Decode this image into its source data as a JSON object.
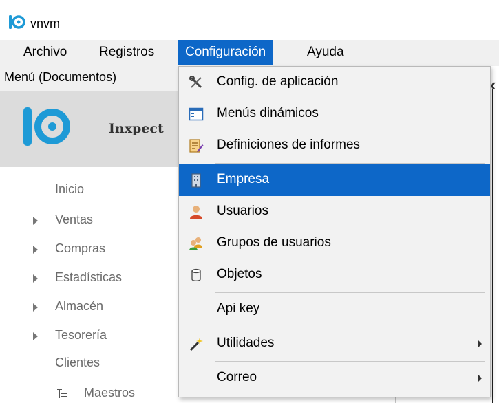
{
  "window": {
    "title": "vnvm"
  },
  "menubar": {
    "items": [
      "Archivo",
      "Registros",
      "Configuración",
      "Ayuda"
    ]
  },
  "left_panel": {
    "header": "Menú (Documentos)",
    "logo_text": "Inxpect",
    "tree": [
      "Inicio",
      "Ventas",
      "Compras",
      "Estadísticas",
      "Almacén",
      "Tesorería",
      "Clientes",
      "Maestros"
    ]
  },
  "dropdown": {
    "items": [
      {
        "label": "Config. de aplicación",
        "icon": "wrench-screwdriver-icon"
      },
      {
        "label": "Menús dinámicos",
        "icon": "window-list-icon"
      },
      {
        "label": "Definiciones de informes",
        "icon": "report-edit-icon"
      },
      {
        "label": "Empresa",
        "icon": "building-icon"
      },
      {
        "label": "Usuarios",
        "icon": "user-icon"
      },
      {
        "label": "Grupos de usuarios",
        "icon": "users-group-icon"
      },
      {
        "label": "Objetos",
        "icon": "cylinder-icon"
      },
      {
        "label": "Api key",
        "icon": ""
      },
      {
        "label": "Utilidades",
        "icon": "magic-wand-icon"
      },
      {
        "label": "Correo",
        "icon": ""
      }
    ],
    "selected": "Empresa"
  },
  "colors": {
    "accent": "#0d67c8",
    "menubar": "#f0f0f0",
    "logo_band": "#dcdcdc"
  }
}
